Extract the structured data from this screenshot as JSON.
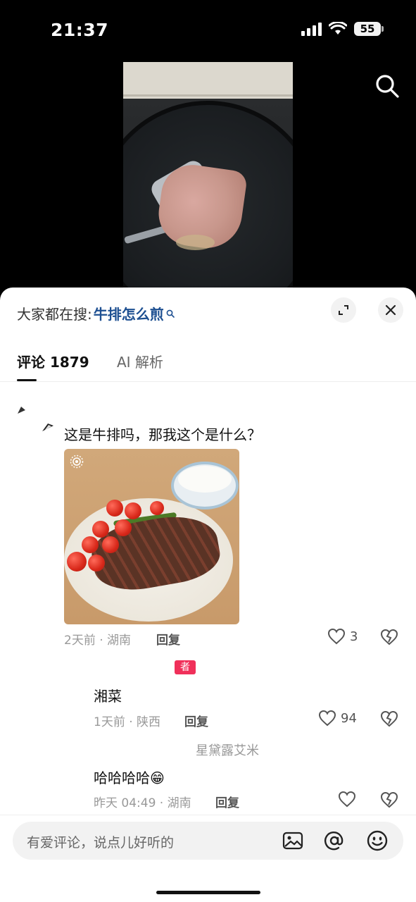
{
  "status_bar": {
    "time": "21:37",
    "battery": "55"
  },
  "sheet_header": {
    "search_prefix": "大家都在搜:",
    "search_keyword": "牛排怎么煎"
  },
  "tabs": [
    {
      "label": "评论 1879"
    },
    {
      "label": "AI 解析"
    }
  ],
  "comments": [
    {
      "text": "这是牛排吗，那我这个是什么？",
      "meta": "2天前 · 湖南",
      "reply": "回复",
      "likes": "3"
    },
    {
      "text": "湘菜",
      "meta": "1天前 · 陕西",
      "reply": "回复",
      "likes": "94",
      "tag": "者"
    },
    {
      "username": "星黛露艾米",
      "text": "哈哈哈哈😁",
      "meta": "昨天 04:49 · 湖南",
      "reply": "回复",
      "likes": ""
    }
  ],
  "input": {
    "placeholder": "有爱评论，说点儿好听的"
  },
  "icons": [
    "search-icon",
    "expand-icon",
    "close-icon",
    "heart-icon",
    "broken-heart-icon",
    "image-icon",
    "at-icon",
    "emoji-icon",
    "live-photo-icon"
  ]
}
